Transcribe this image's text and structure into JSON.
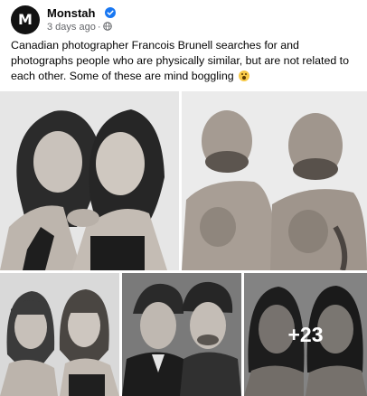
{
  "post": {
    "avatar_letter": "M",
    "page_name": "Monstah",
    "timestamp": "3 days ago",
    "separator": "·",
    "text": "Canadian photographer Francois Brunell searches for and photographs people who are physically similar, but are not related to each other. Some of these are mind boggling",
    "emoji": "astonished-face-emoji"
  },
  "gallery": {
    "more_count": "+23"
  },
  "colors": {
    "verified_badge": "#1877f2",
    "meta_text": "#65676b"
  }
}
